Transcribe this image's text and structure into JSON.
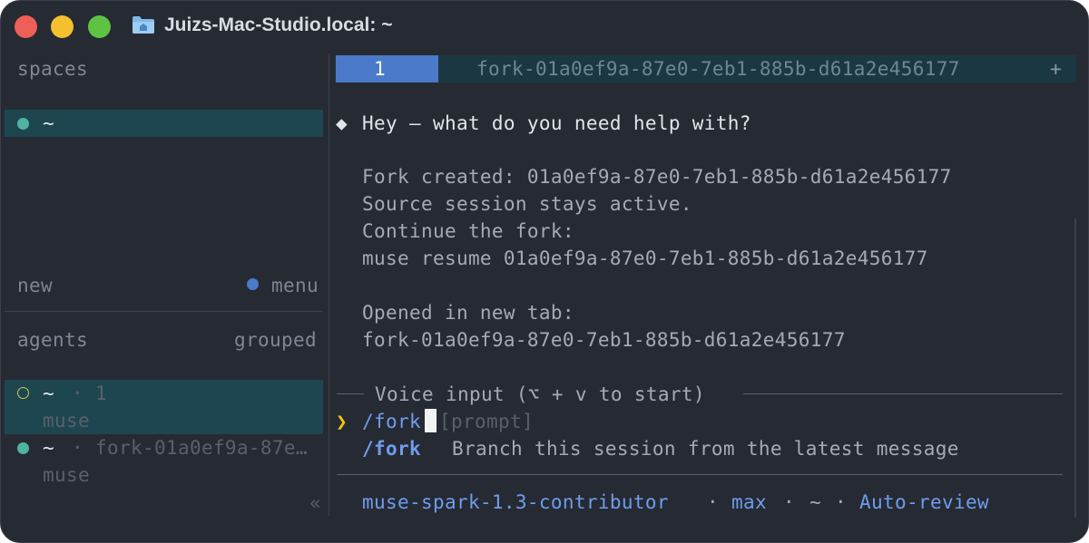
{
  "window": {
    "title": "Juizs-Mac-Studio.local: ~"
  },
  "sidebar": {
    "spaces_header": "spaces",
    "spaces": [
      {
        "label": "~",
        "selected": true
      }
    ],
    "new_label": "new",
    "menu_label": "menu",
    "agents_header": "agents",
    "grouped_label": "grouped",
    "agents": [
      {
        "space": "~",
        "sep": "·",
        "name": "1",
        "sub": "muse",
        "selected": true,
        "status": "idle"
      },
      {
        "space": "~",
        "sep": "·",
        "name": "fork-01a0ef9a-87e…",
        "sub": "muse",
        "selected": false,
        "status": "active"
      }
    ],
    "collapse_icon": "«"
  },
  "tabs": {
    "items": [
      {
        "label": "1",
        "active": true
      },
      {
        "label": "fork-01a0ef9a-87e0-7eb1-885b-d61a2e456177",
        "active": false
      }
    ],
    "add_label": "+"
  },
  "transcript": {
    "bullet": "◆",
    "greeting": "Hey — what do you need help with?",
    "lines": [
      "Fork created: 01a0ef9a-87e0-7eb1-885b-d61a2e456177",
      "Source session stays active.",
      "Continue the fork:",
      "muse resume 01a0ef9a-87e0-7eb1-885b-d61a2e456177",
      "",
      "Opened in new tab:",
      "fork-01a0ef9a-87e0-7eb1-885b-d61a2e456177"
    ]
  },
  "input": {
    "voice_hint": "Voice input (⌥ + v to start)",
    "prompt_symbol": "❯",
    "value": "/fork",
    "placeholder": "[prompt]"
  },
  "suggestion": {
    "command": "/fork",
    "description": "Branch this session from the latest message"
  },
  "status_bar": {
    "model": "muse-spark-1.3-contributor",
    "sep1": "·",
    "effort": "max",
    "sep2": "·",
    "cwd": "~",
    "sep3": "·",
    "mode": "Auto-review"
  },
  "colors": {
    "background": "#262a33",
    "selection": "#1d4650",
    "accent_blue": "#4a7ac9",
    "link_blue": "#6f9cee",
    "prompt_yellow": "#f1c40f",
    "status_green": "#4fb3a1"
  }
}
